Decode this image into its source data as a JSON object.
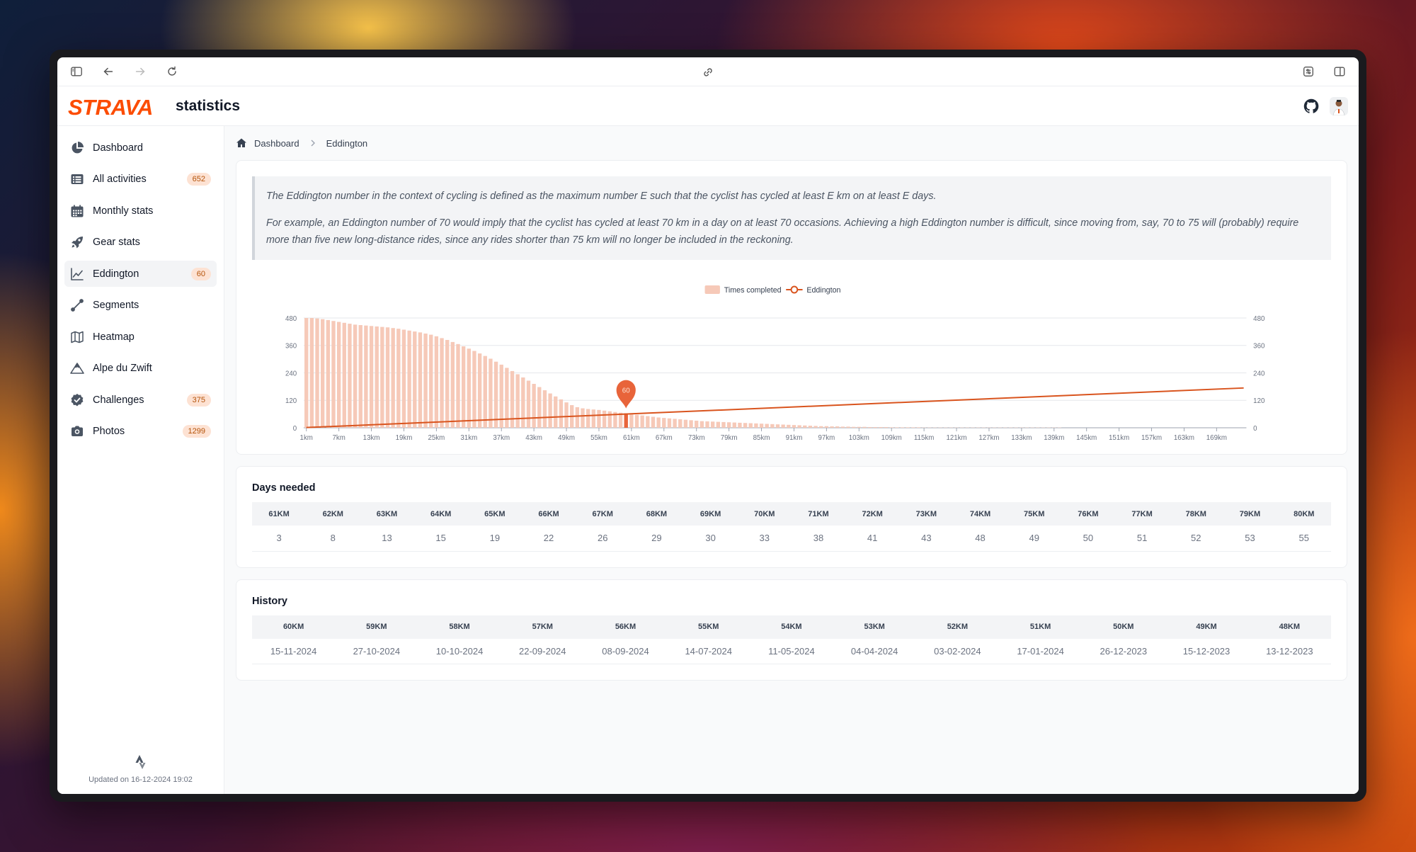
{
  "browser": {
    "icons": [
      "sidebar-toggle-icon",
      "back-arrow-icon",
      "forward-arrow-icon",
      "reload-icon",
      "link-icon",
      "extensions-icon",
      "split-view-icon"
    ]
  },
  "header": {
    "brand": "STRAVA",
    "title": "statistics"
  },
  "sidebar": {
    "items": [
      {
        "label": "Dashboard",
        "icon": "pie-chart-icon",
        "badge": ""
      },
      {
        "label": "All activities",
        "icon": "list-icon",
        "badge": "652"
      },
      {
        "label": "Monthly stats",
        "icon": "calendar-icon",
        "badge": ""
      },
      {
        "label": "Gear stats",
        "icon": "rocket-icon",
        "badge": ""
      },
      {
        "label": "Eddington",
        "icon": "line-chart-icon",
        "badge": "60"
      },
      {
        "label": "Segments",
        "icon": "segment-icon",
        "badge": ""
      },
      {
        "label": "Heatmap",
        "icon": "map-icon",
        "badge": ""
      },
      {
        "label": "Alpe du Zwift",
        "icon": "mountain-icon",
        "badge": ""
      },
      {
        "label": "Challenges",
        "icon": "badge-check-icon",
        "badge": "375"
      },
      {
        "label": "Photos",
        "icon": "camera-icon",
        "badge": "1299"
      }
    ],
    "active": "Eddington",
    "footer": "Updated on 16-12-2024 19:02"
  },
  "breadcrumb": {
    "home": "Dashboard",
    "current": "Eddington"
  },
  "info": {
    "p1": "The Eddington number in the context of cycling is defined as the maximum number E such that the cyclist has cycled at least E km on at least E days.",
    "p2": "For example, an Eddington number of 70 would imply that the cyclist has cycled at least 70 km in a day on at least 70 occasions. Achieving a high Eddington number is difficult, since moving from, say, 70 to 75 will (probably) require more than five new long-distance rides, since any rides shorter than 75 km will no longer be included in the reckoning."
  },
  "chart_data": {
    "type": "bar",
    "legend": [
      "Times completed",
      "Eddington"
    ],
    "legend_position": "top-center",
    "x_tick_labels": [
      "1km",
      "7km",
      "13km",
      "19km",
      "25km",
      "31km",
      "37km",
      "43km",
      "49km",
      "55km",
      "61km",
      "67km",
      "73km",
      "79km",
      "85km",
      "91km",
      "97km",
      "103km",
      "109km",
      "115km",
      "121km",
      "127km",
      "133km",
      "139km",
      "145km",
      "151km",
      "157km",
      "163km",
      "169km"
    ],
    "y_ticks": [
      0,
      120,
      240,
      360,
      480
    ],
    "ylim": [
      0,
      480
    ],
    "x_range_km": [
      1,
      174
    ],
    "series": [
      {
        "name": "Times completed",
        "color": "#f6c9b8",
        "values": [
          480,
          480,
          478,
          475,
          471,
          467,
          463,
          459,
          455,
          451,
          449,
          447,
          445,
          443,
          441,
          439,
          436,
          433,
          429,
          425,
          421,
          417,
          412,
          407,
          400,
          392,
          384,
          375,
          366,
          356,
          346,
          336,
          325,
          314,
          302,
          289,
          276,
          262,
          248,
          234,
          220,
          206,
          192,
          178,
          164,
          150,
          137,
          124,
          111,
          99,
          90,
          85,
          82,
          80,
          78,
          75,
          72,
          69,
          66,
          63,
          60,
          57,
          54,
          51,
          48,
          45,
          43,
          41,
          39,
          37,
          35,
          33,
          31,
          29,
          28,
          27,
          26,
          25,
          24,
          23,
          22,
          21,
          20,
          19,
          18,
          17,
          16,
          15,
          14,
          13,
          12,
          11,
          10,
          9,
          8,
          7,
          7,
          6,
          6,
          5,
          5,
          4,
          4,
          4,
          3,
          3,
          3,
          3,
          2,
          2,
          2,
          2,
          2,
          2,
          1,
          1,
          1,
          1,
          1,
          1,
          1,
          1,
          1,
          1,
          1,
          1,
          1,
          1,
          1,
          1,
          1,
          1,
          1,
          1,
          1,
          1,
          1,
          1,
          1,
          1,
          0,
          0,
          0,
          0,
          0,
          0,
          0,
          0,
          0,
          0,
          0,
          0,
          0,
          0,
          0,
          0,
          0,
          0,
          0,
          0,
          0,
          0,
          0,
          0,
          0,
          0,
          0,
          0,
          0,
          0,
          0,
          0,
          0,
          0
        ]
      },
      {
        "name": "Eddington",
        "color": "#d9541e",
        "type": "line",
        "values_equal_x": true
      }
    ],
    "highlight": {
      "x": 60,
      "label": "60",
      "color": "#e8643a"
    }
  },
  "days_needed": {
    "title": "Days needed",
    "headers": [
      "61KM",
      "62KM",
      "63KM",
      "64KM",
      "65KM",
      "66KM",
      "67KM",
      "68KM",
      "69KM",
      "70KM",
      "71KM",
      "72KM",
      "73KM",
      "74KM",
      "75KM",
      "76KM",
      "77KM",
      "78KM",
      "79KM",
      "80KM"
    ],
    "values": [
      "3",
      "8",
      "13",
      "15",
      "19",
      "22",
      "26",
      "29",
      "30",
      "33",
      "38",
      "41",
      "43",
      "48",
      "49",
      "50",
      "51",
      "52",
      "53",
      "55"
    ]
  },
  "history": {
    "title": "History",
    "headers": [
      "60KM",
      "59KM",
      "58KM",
      "57KM",
      "56KM",
      "55KM",
      "54KM",
      "53KM",
      "52KM",
      "51KM",
      "50KM",
      "49KM",
      "48KM"
    ],
    "values": [
      "15-11-2024",
      "27-10-2024",
      "10-10-2024",
      "22-09-2024",
      "08-09-2024",
      "14-07-2024",
      "11-05-2024",
      "04-04-2024",
      "03-02-2024",
      "17-01-2024",
      "26-12-2023",
      "15-12-2023",
      "13-12-2023"
    ]
  }
}
